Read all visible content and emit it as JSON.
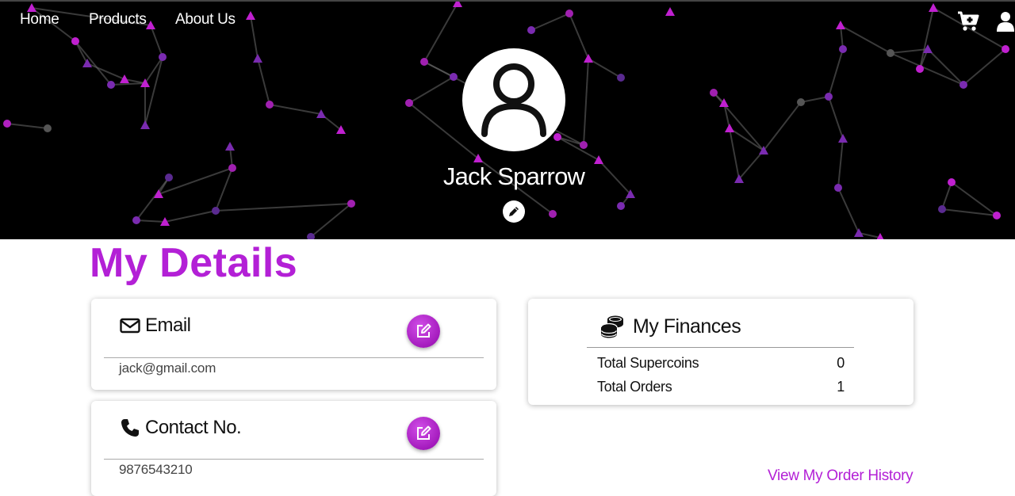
{
  "nav": {
    "home": "Home",
    "products": "Products",
    "about": "About Us",
    "cart_icon": "cart-plus-icon",
    "user_icon": "user-icon"
  },
  "profile": {
    "name": "Jack Sparrow",
    "avatar_icon": "user-outline-icon",
    "edit_icon": "pencil-icon"
  },
  "details": {
    "title": "My Details",
    "email": {
      "label": "Email",
      "value": "jack@gmail.com",
      "icon": "envelope-icon"
    },
    "contact": {
      "label": "Contact No.",
      "value": "9876543210",
      "icon": "phone-icon"
    }
  },
  "finances": {
    "title": "My Finances",
    "icon": "coins-icon",
    "rows": [
      {
        "label": "Total Supercoins",
        "value": "0"
      },
      {
        "label": "Total Orders",
        "value": "1"
      }
    ]
  },
  "order_history_link": "View My Order History",
  "colors": {
    "accent": "#b320d6",
    "hero_bg": "#000000"
  }
}
